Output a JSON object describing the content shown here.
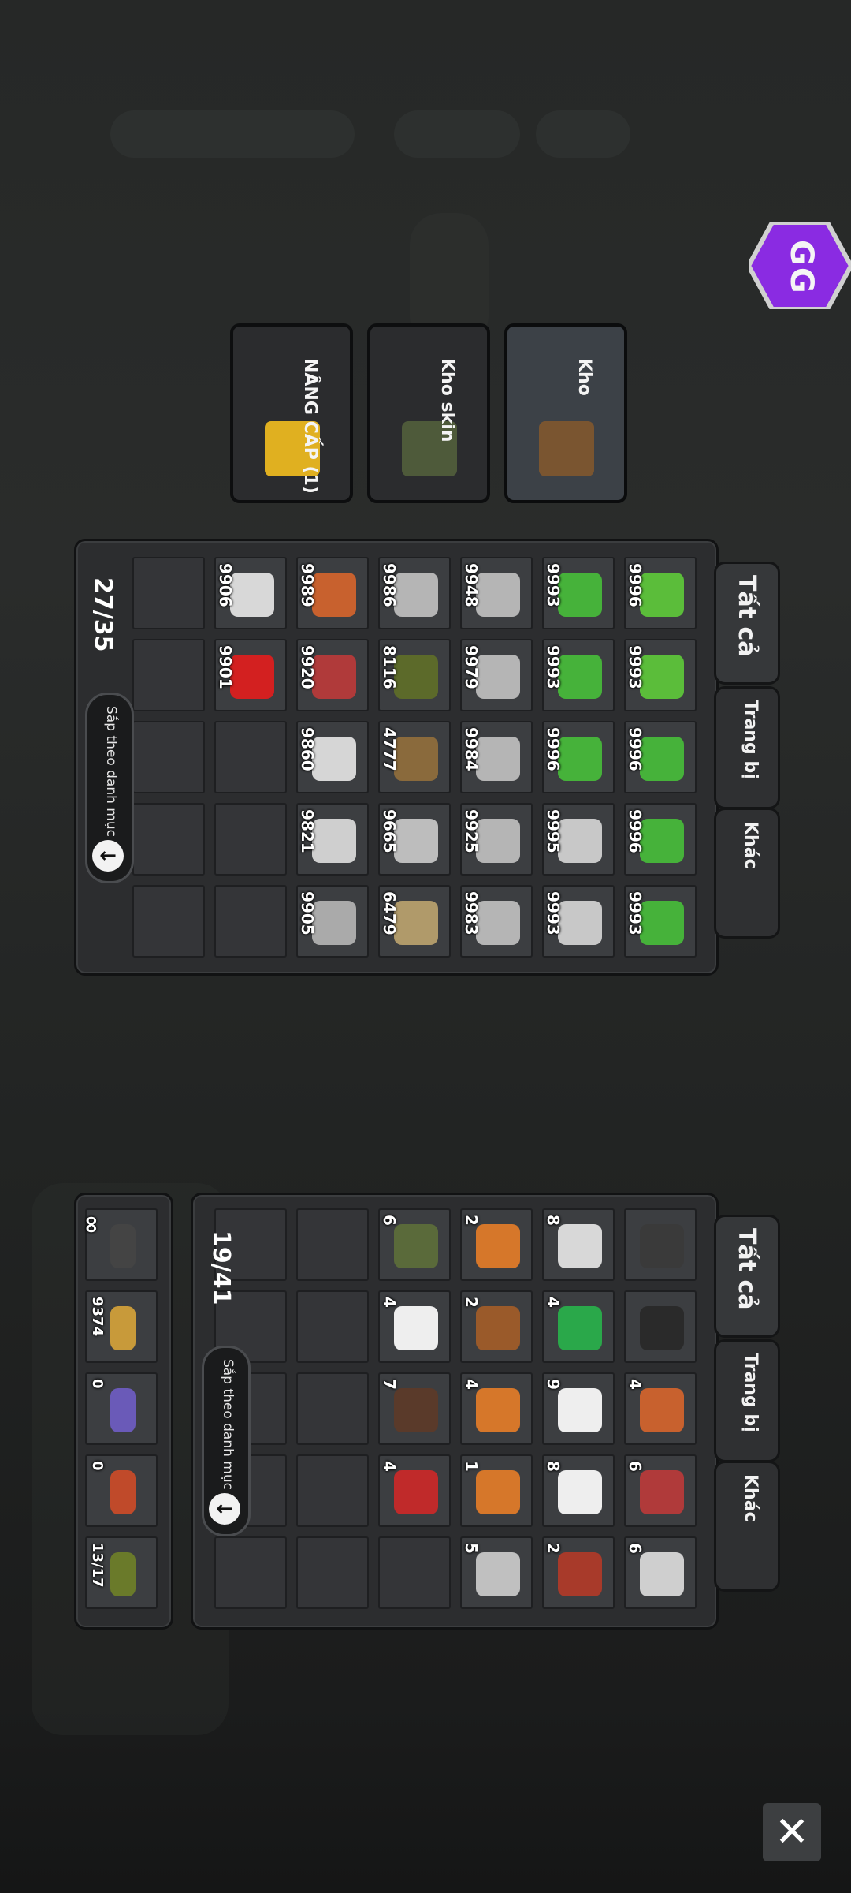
{
  "top_panel": {
    "tabs": [
      "Tất cả",
      "Trang bị",
      "Khác"
    ],
    "counter": "27/35",
    "sort_label": "Sắp theo danh mục",
    "rows": [
      [
        {
          "count": "9996",
          "icon": "green-spool-icon",
          "color": "#5bbd3a"
        },
        {
          "count": "9993",
          "icon": "green-wire-icon",
          "color": "#5bbd3a"
        },
        {
          "count": "9996",
          "icon": "green-glove-icon",
          "color": "#46b23a"
        },
        {
          "count": "9996",
          "icon": "green-glove-icon",
          "color": "#46b23a"
        },
        {
          "count": "9993",
          "icon": "green-glove-icon",
          "color": "#46b23a"
        }
      ],
      [
        {
          "count": "9993",
          "icon": "green-glove-icon",
          "color": "#46b23a"
        },
        {
          "count": "9993",
          "icon": "green-glove-icon",
          "color": "#46b23a"
        },
        {
          "count": "9996",
          "icon": "green-glove-icon",
          "color": "#46b23a"
        },
        {
          "count": "9995",
          "icon": "wire-spool-icon",
          "color": "#c8c8c8"
        },
        {
          "count": "9993",
          "icon": "wire-spool-icon",
          "color": "#c8c8c8"
        }
      ],
      [
        {
          "count": "9948",
          "icon": "gray-glove-icon",
          "color": "#b5b5b5"
        },
        {
          "count": "9979",
          "icon": "gray-glove-icon",
          "color": "#b5b5b5"
        },
        {
          "count": "9984",
          "icon": "gray-glove-icon",
          "color": "#b5b5b5"
        },
        {
          "count": "9925",
          "icon": "gray-glove-icon",
          "color": "#b5b5b5"
        },
        {
          "count": "9983",
          "icon": "gray-glove-icon",
          "color": "#b5b5b5"
        }
      ],
      [
        {
          "count": "9986",
          "icon": "gray-glove-icon",
          "color": "#b5b5b5"
        },
        {
          "count": "8116",
          "icon": "jerrycan-icon",
          "color": "#5c6a2a"
        },
        {
          "count": "4777",
          "icon": "rope-icon",
          "color": "#8a6a3c"
        },
        {
          "count": "9665",
          "icon": "metal-plate-icon",
          "color": "#bdbdbd"
        },
        {
          "count": "6479",
          "icon": "cloth-icon",
          "color": "#b09a6a"
        }
      ],
      [
        {
          "count": "9989",
          "icon": "orange-cap-icon",
          "color": "#c8612e"
        },
        {
          "count": "9920",
          "icon": "tools-icon",
          "color": "#b03a3a"
        },
        {
          "count": "9860",
          "icon": "engine-part-icon",
          "color": "#d6d6d6"
        },
        {
          "count": "9821",
          "icon": "duct-tape-icon",
          "color": "#cfcfcf"
        },
        {
          "count": "9905",
          "icon": "pipe-icon",
          "color": "#aaaaaa"
        }
      ],
      [
        {
          "count": "9906",
          "icon": "battery-icon",
          "color": "#d8d8d8"
        },
        {
          "count": "9901",
          "icon": "ruby-icon",
          "color": "#d32020"
        },
        null,
        null,
        null
      ],
      [
        null,
        null,
        null,
        null,
        null
      ]
    ]
  },
  "bottom_panel": {
    "tabs": [
      "Tất cả",
      "Trang bị",
      "Khác"
    ],
    "counter": "19/41",
    "sort_label": "Sắp theo danh mục",
    "rows": [
      [
        {
          "count": "",
          "icon": "weapon-part-icon",
          "color": "#3a3a3a"
        },
        {
          "count": "",
          "icon": "camera-icon",
          "color": "#2a2a2a"
        },
        {
          "count": "4",
          "icon": "orange-cap-icon",
          "color": "#c8612e"
        },
        {
          "count": "6",
          "icon": "tools-icon",
          "color": "#b03a3a"
        },
        {
          "count": "6",
          "icon": "duct-tape-icon",
          "color": "#cfcfcf"
        }
      ],
      [
        {
          "count": "8",
          "icon": "battery-icon",
          "color": "#d8d8d8"
        },
        {
          "count": "4",
          "icon": "first-aid-kit-icon",
          "color": "#2aa84a"
        },
        {
          "count": "9",
          "icon": "bandage-icon",
          "color": "#eeeeee"
        },
        {
          "count": "8",
          "icon": "bandage-icon",
          "color": "#eeeeee"
        },
        {
          "count": "2",
          "icon": "raw-meat-icon",
          "color": "#a83a2a"
        }
      ],
      [
        {
          "count": "2",
          "icon": "food-bowl-icon",
          "color": "#d6772a"
        },
        {
          "count": "2",
          "icon": "kebab-icon",
          "color": "#9a5a2a"
        },
        {
          "count": "4",
          "icon": "food-bowl-icon",
          "color": "#d6772a"
        },
        {
          "count": "1",
          "icon": "food-bowl-icon",
          "color": "#d6772a"
        },
        {
          "count": "5",
          "icon": "tuna-can-icon",
          "color": "#c0c0c0"
        }
      ],
      [
        {
          "count": "6",
          "icon": "meal-bag-icon",
          "color": "#5a6a3a"
        },
        {
          "count": "4",
          "icon": "flour-bag-icon",
          "color": "#eeeeee"
        },
        {
          "count": "7",
          "icon": "chocolate-icon",
          "color": "#5a3a2a"
        },
        {
          "count": "4",
          "icon": "soda-can-icon",
          "color": "#c02a2a"
        },
        null
      ],
      [
        null,
        null,
        null,
        null,
        null
      ],
      [
        null,
        null,
        null,
        null,
        null
      ]
    ]
  },
  "ammo_panel": {
    "slots": [
      {
        "count": "∞",
        "icon": "bullet-black-icon",
        "color": "#444444"
      },
      {
        "count": "9374",
        "icon": "bullet-gold-icon",
        "color": "#c89a3a"
      },
      {
        "count": "0",
        "icon": "bullet-purple-icon",
        "color": "#6a5ab8"
      },
      {
        "count": "0",
        "icon": "bullet-red-icon",
        "color": "#c04a2a"
      },
      {
        "count": "13/17",
        "icon": "grenade-icon",
        "color": "#6a7a2a"
      }
    ]
  },
  "menu": {
    "items": [
      {
        "label": "Kho",
        "icon": "chest-icon",
        "color": "#7a5530",
        "active": true
      },
      {
        "label": "Kho skin",
        "icon": "skin-crate-icon",
        "color": "#4e5a3a",
        "active": false
      },
      {
        "label": "NÂNG CẤP (1)",
        "icon": "drill-icon",
        "color": "#e0b020",
        "active": false
      }
    ]
  },
  "gg_badge": {
    "text": "GG",
    "color": "#8a2be2"
  },
  "close_label": "✕"
}
